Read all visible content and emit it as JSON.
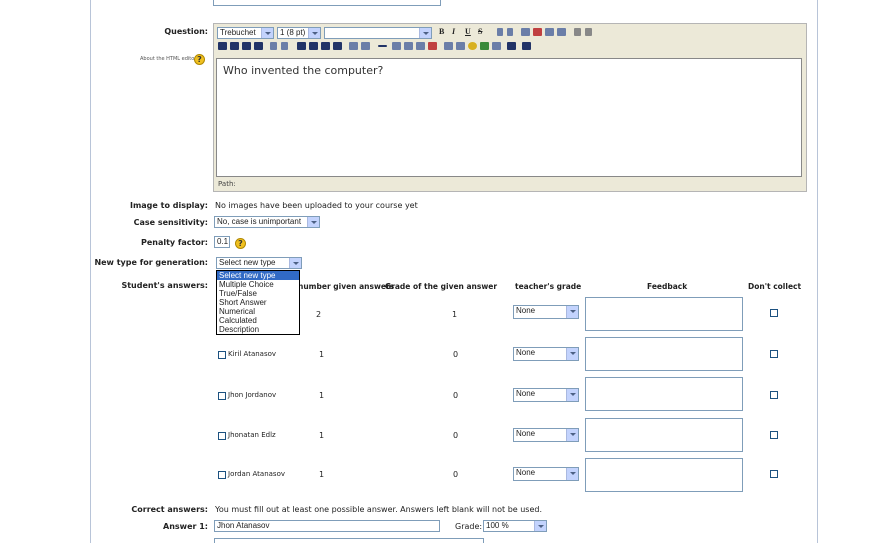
{
  "labels": {
    "question": "Question:",
    "about_editor": "About the HTML editor",
    "image_to_display": "Image to display:",
    "case_sensitivity": "Case sensitivity:",
    "penalty_factor": "Penalty factor:",
    "new_type": "New type for generation:",
    "students_answers": "Student's answers:",
    "correct_answers": "Correct answers:",
    "answer1": "Answer 1:",
    "grade": "Grade:"
  },
  "toolbar": {
    "font": "Trebuchet",
    "size": "1 (8 pt)",
    "heading": "",
    "bold": "B",
    "italic": "I",
    "underline": "U",
    "strike": "S"
  },
  "editor": {
    "content": "Who invented the computer?",
    "path": "Path:"
  },
  "image_text": "No images have been uploaded to your course yet",
  "case_value": "No, case is unimportant",
  "penalty_value": "0.1",
  "new_type_value": "Select new type",
  "type_options": [
    "Select new type",
    "Multiple Choice",
    "True/False",
    "Short Answer",
    "Numerical",
    "Calculated",
    "Description"
  ],
  "table": {
    "headers": [
      "number given answers",
      "Grade of the given answer",
      "teacher's grade",
      "Feedback",
      "Don't collect"
    ],
    "rows": [
      {
        "name": "",
        "count": "2",
        "grade": "1",
        "teacher": "None"
      },
      {
        "name": "Kiril Atanasov",
        "count": "1",
        "grade": "0",
        "teacher": "None"
      },
      {
        "name": "Jhon Jordanov",
        "count": "1",
        "grade": "0",
        "teacher": "None"
      },
      {
        "name": "Jhonatan Edlz",
        "count": "1",
        "grade": "0",
        "teacher": "None"
      },
      {
        "name": "Jordan Atanasov",
        "count": "1",
        "grade": "0",
        "teacher": "None"
      }
    ]
  },
  "correct_text": "You must fill out at least one possible answer. Answers left blank will not be used.",
  "answer1_value": "Jhon Atanasov",
  "grade_value": "100 %"
}
